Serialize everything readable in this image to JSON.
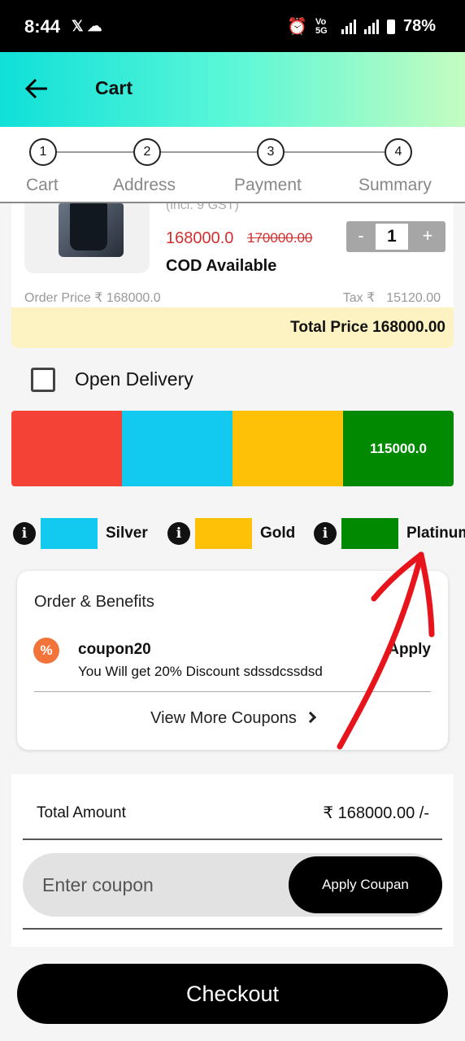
{
  "status_bar": {
    "time": "8:44",
    "left_icons": "𝕏 ☁",
    "net_label": "Vo 5G",
    "battery": "78%"
  },
  "app_bar": {
    "title": "Cart",
    "back_icon": "arrow-left-icon"
  },
  "stepper": {
    "steps": [
      {
        "number": "1",
        "label": "Cart"
      },
      {
        "number": "2",
        "label": "Address"
      },
      {
        "number": "3",
        "label": "Payment"
      },
      {
        "number": "4",
        "label": "Summary"
      }
    ]
  },
  "product": {
    "gst_note": "(incl. 9 GST)",
    "price": "168000.0",
    "original_price": "170000.00",
    "cod_text": "COD Available",
    "quantity": "1",
    "qty_minus": "-",
    "qty_plus": "+",
    "order_price": "Order Price ₹ 168000.0",
    "tax_label": "Tax ₹",
    "tax_value": "15120.00",
    "total_price": "Total Price 168000.00"
  },
  "open_delivery": {
    "label": "Open Delivery",
    "checked": false
  },
  "tier_bar": {
    "segments": [
      {
        "color": "#f44336",
        "label": ""
      },
      {
        "color": "#12c9ef",
        "label": ""
      },
      {
        "color": "#ffc107",
        "label": ""
      },
      {
        "color": "#018a01",
        "label": "115000.0"
      }
    ]
  },
  "tier_legend": [
    {
      "name": "Silver",
      "color": "#12c9ef"
    },
    {
      "name": "Gold",
      "color": "#ffc107"
    },
    {
      "name": "Platinum",
      "color": "#018a01"
    }
  ],
  "benefits": {
    "title": "Order & Benefits",
    "coupon_icon": "percent-badge-icon",
    "coupon_code": "coupon20",
    "coupon_desc": "You Will get 20% Discount sdssdcssdsd",
    "apply_label": "Apply",
    "view_more": "View More Coupons"
  },
  "summary": {
    "total_label": "Total Amount",
    "total_value": "₹ 168000.00 /-",
    "coupon_placeholder": "Enter coupon",
    "apply_coupon_label": "Apply Coupan"
  },
  "checkout": {
    "label": "Checkout"
  },
  "colors": {
    "app_bar_gradient": [
      "#0fe0d8",
      "#5bf7d8",
      "#c3fcc0"
    ],
    "price_red": "#d32f2f",
    "total_strip": "#fdf2c2",
    "annotation_arrow": "#e8141c"
  }
}
